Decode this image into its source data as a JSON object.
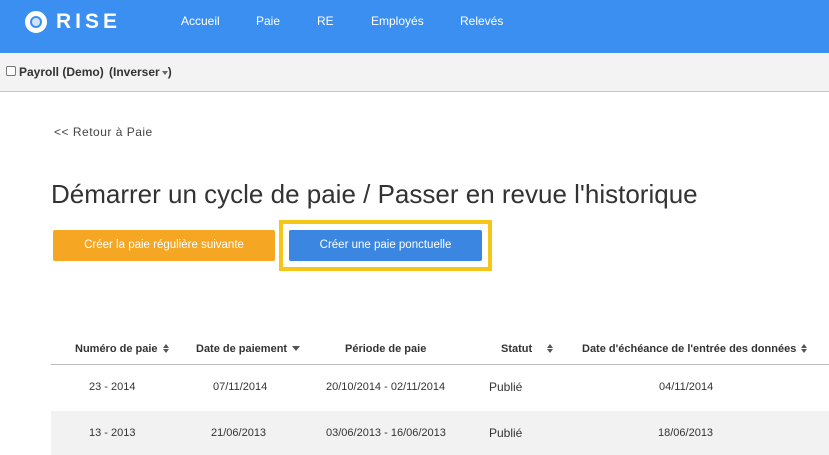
{
  "app": {
    "logo_text": "RISE"
  },
  "nav": {
    "items": [
      {
        "label": "Accueil"
      },
      {
        "label": "Paie"
      },
      {
        "label": "RE"
      },
      {
        "label": "Employés"
      },
      {
        "label": "Relevés"
      }
    ]
  },
  "company": {
    "name": "Payroll (Demo)",
    "switch_label": "(Inverser"
  },
  "page": {
    "back_link": "<< Retour à Paie",
    "title": "Démarrer un cycle de paie / Passer en revue l'historique"
  },
  "actions": {
    "regular_label": "Créer la paie régulière suivante",
    "oneoff_label": "Créer une paie ponctuelle"
  },
  "table": {
    "headers": {
      "number": "Numéro de paie",
      "pay_date": "Date de paiement",
      "period": "Période de paie",
      "status": "Statut",
      "due_date": "Date d'échéance de l'entrée des données"
    },
    "rows": [
      {
        "number": "23 - 2014",
        "pay_date": "07/11/2014",
        "period": "20/10/2014 - 02/11/2014",
        "status": "Publié",
        "due_date": "04/11/2014"
      },
      {
        "number": "13 - 2013",
        "pay_date": "21/06/2013",
        "period": "03/06/2013 - 16/06/2013",
        "status": "Publié",
        "due_date": "18/06/2013"
      }
    ]
  },
  "colors": {
    "topbar": "#3b8ff0",
    "regular_button": "#f5a623",
    "oneoff_button": "#3a86e0",
    "highlight": "#f5c518"
  }
}
